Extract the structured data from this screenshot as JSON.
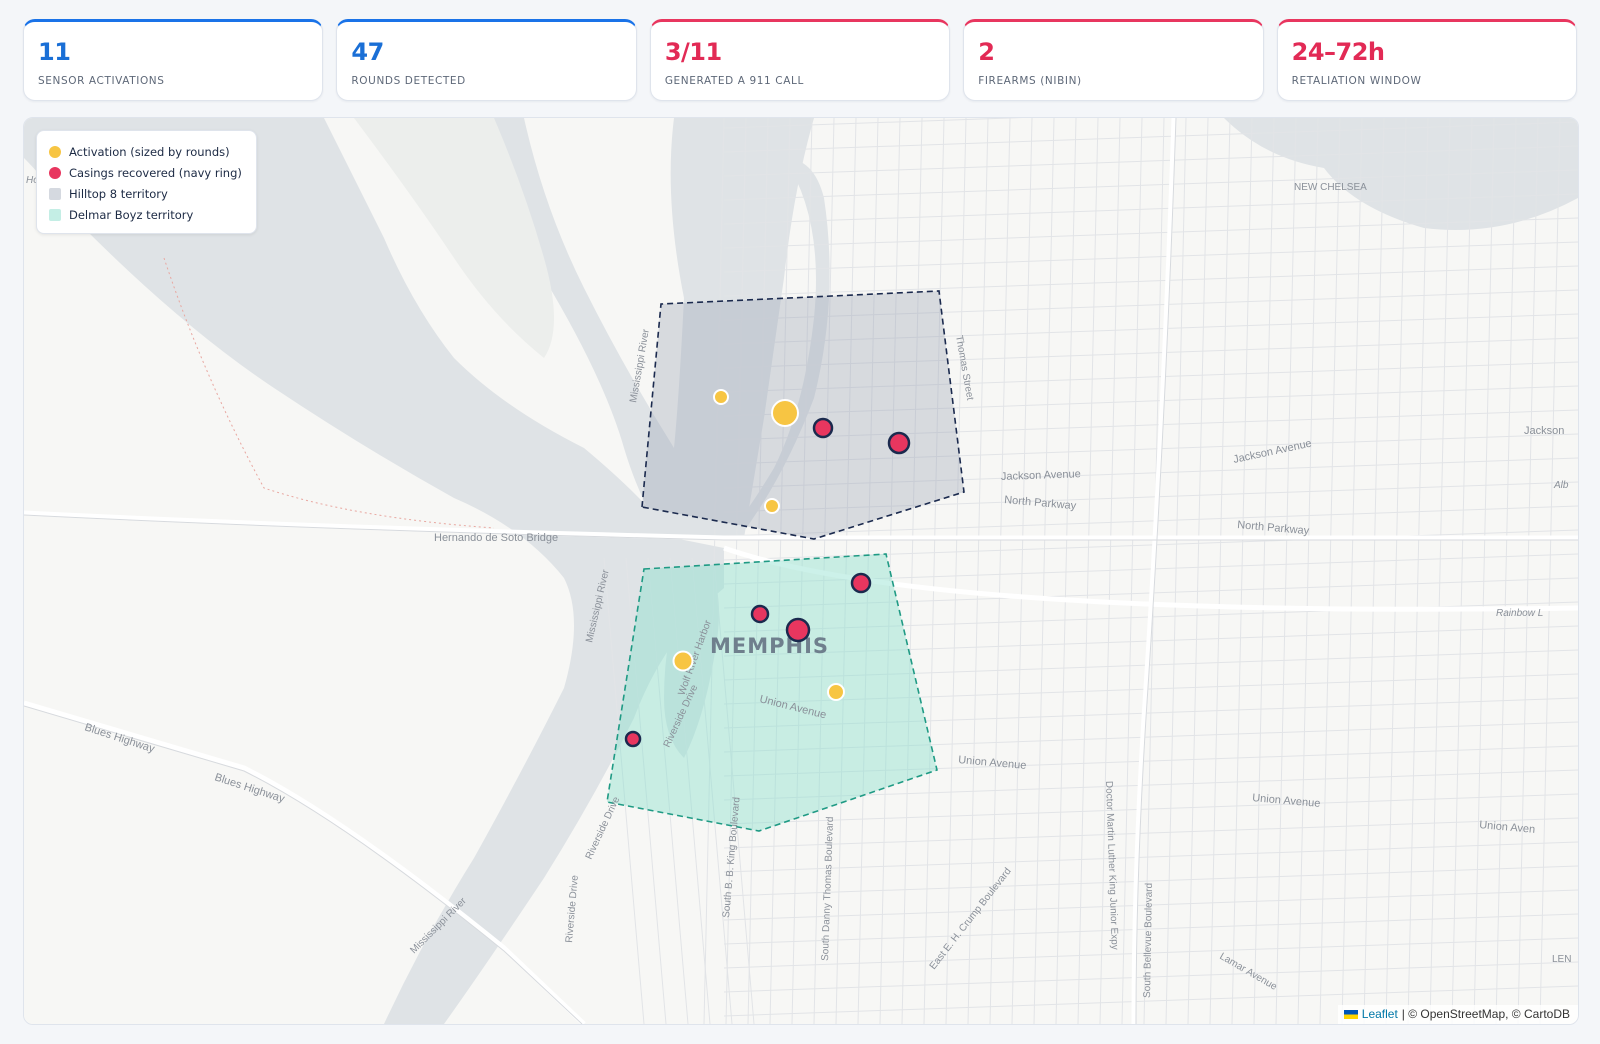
{
  "stats": [
    {
      "value": "11",
      "label": "Sensor activations",
      "alert": false
    },
    {
      "value": "47",
      "label": "Rounds detected",
      "alert": false
    },
    {
      "value": "3/11",
      "label": "Generated a 911 call",
      "alert": true
    },
    {
      "value": "2",
      "label": "Firearms (NIBIN)",
      "alert": true
    },
    {
      "value": "24–72h",
      "label": "Retaliation window",
      "alert": true
    }
  ],
  "legend": {
    "items": [
      {
        "label": "Activation (sized by rounds)",
        "color": "#f7c543",
        "shape": "dot"
      },
      {
        "label": "Casings recovered (navy ring)",
        "color": "#e8365f",
        "shape": "dot"
      },
      {
        "label": "Hilltop 8 territory",
        "color": "#d5d9e0",
        "shape": "square"
      },
      {
        "label": "Delmar Boyz territory",
        "color": "#c4eee5",
        "shape": "square"
      }
    ]
  },
  "map_labels": {
    "city": "MEMPHIS",
    "new_chelsea": "NEW CHELSEA",
    "bridge": "Hernando de Soto Bridge",
    "river_north": "Mississippi River",
    "river_mid": "Mississippi River",
    "river_south": "Mississippi River",
    "thomas": "Thomas Street",
    "jackson1": "Jackson Avenue",
    "jackson2": "Jackson Avenue",
    "jackson3": "Jackson",
    "north1": "North Parkway",
    "north2": "North Parkway",
    "union1": "Union Avenue",
    "union2": "Union Avenue",
    "union3": "Union Avenue",
    "union4": "Union Aven",
    "blues1": "Blues Highway",
    "blues2": "Blues Highway",
    "riverside1": "Riverside Drive",
    "riverside2": "Riverside Drive",
    "riverside3": "Riverside Drive",
    "wolf": "Wolf River Harbor",
    "bbking": "South B. B. King Boulevard",
    "danny": "South Danny Thomas Boulevard",
    "crump": "East E. H. Crump Boulevard",
    "mlk": "Doctor Martin Luther King Junior Expy",
    "bellevue": "South Bellevue Boulevard",
    "lamar": "Lamar Avenue",
    "rainbow": "Rainbow L",
    "alb": "Alb",
    "len": "LEN",
    "ho": "Ho"
  },
  "attribution": {
    "leaflet": "Leaflet",
    "rest": "| © OpenStreetMap, © CartoDB"
  },
  "colors": {
    "activation": "#f7c543",
    "casing": "#e8365f",
    "navy": "#1b2a4e",
    "hilltop_fill": "#9aa3b5",
    "hilltop_stroke": "#1b2a4e",
    "delmar_fill": "#8fe0cf",
    "delmar_stroke": "#1f9a84"
  }
}
